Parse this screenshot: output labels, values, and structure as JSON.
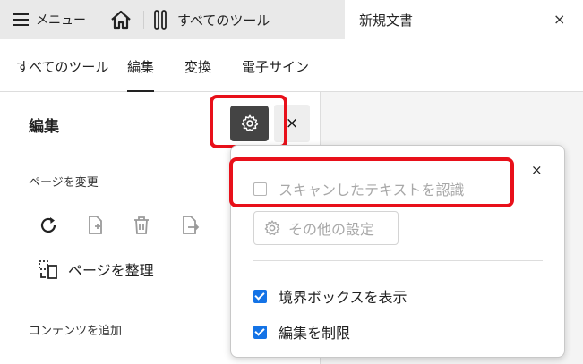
{
  "tabbar": {
    "menu_label": "メニュー",
    "tools_tab_label": "すべてのツール",
    "doc_tab_label": "新規文書",
    "close_symbol": "×"
  },
  "toolbar": {
    "items": [
      "すべてのツール",
      "編集",
      "変換",
      "電子サイン"
    ],
    "active": "編集"
  },
  "panel": {
    "title": "編集",
    "close_symbol": "×",
    "section_page": "ページを変更",
    "organize_label": "ページを整理",
    "section_content": "コンテンツを追加"
  },
  "popover": {
    "close_symbol": "×",
    "recognize_label": "スキャンしたテキストを認識",
    "recognize_checked": false,
    "recognize_disabled": true,
    "more_settings_label": "その他の設定",
    "bbox_label": "境界ボックスを表示",
    "bbox_checked": true,
    "restrict_label": "編集を制限",
    "restrict_checked": true
  },
  "colors": {
    "highlight": "#e8101a",
    "checkbox_blue": "#1473e6",
    "gear_button_bg": "#444444"
  }
}
